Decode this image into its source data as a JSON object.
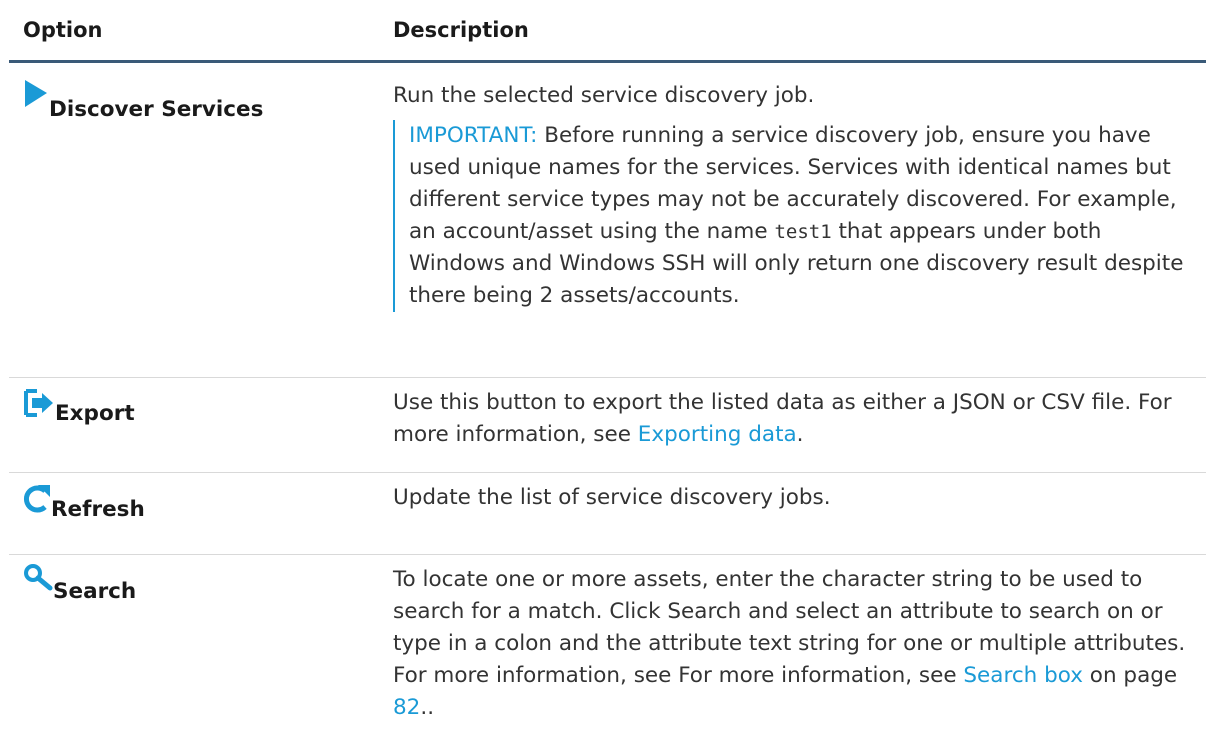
{
  "header": {
    "option": "Option",
    "description": "Description"
  },
  "rows": [
    {
      "icon": "play-icon",
      "label": "Discover Services",
      "description": "Run the selected service discovery job.",
      "important": {
        "label": "IMPORTANT:",
        "text_1": " Before running a service discovery job, ensure you have used unique names for the services. Services with identical names but different service types may not be accur­ately discovered. For example, an account/asset using the name ",
        "code": "test1",
        "text_2": " that appears under both Windows and Windows SSH will only return one discovery result despite there being 2 assets/accounts."
      }
    },
    {
      "icon": "export-icon",
      "label": "Export",
      "description": "Use this button to export the listed data as either a JSON or CSV file. For more information, see ",
      "link": "Exporting data",
      "suffix": "."
    },
    {
      "icon": "refresh-icon",
      "label": "Refresh",
      "description": "Update the list of service discovery jobs."
    },
    {
      "icon": "search-icon",
      "label": "Search",
      "description": "To locate one or more assets, enter the character string to be used to search for a match. Click Search and select an attribute to search on or type in a colon and the attribute text string for one or multiple attributes. For more information, see For more information, see ",
      "link": "Search box",
      "mid": " on page ",
      "page_link": "82",
      "suffix": ".."
    }
  ],
  "colors": {
    "accent": "#1a9ad6",
    "header_rule": "#3a5a78"
  }
}
